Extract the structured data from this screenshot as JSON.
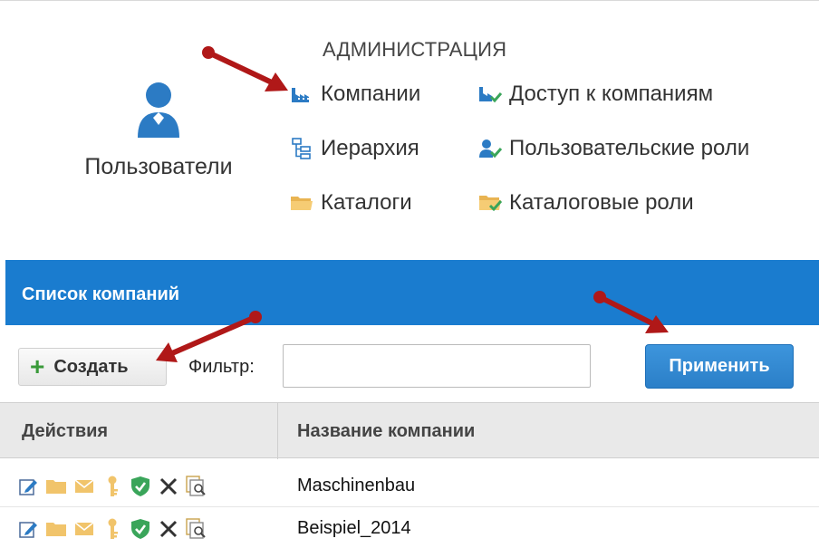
{
  "users": {
    "label": "Пользователи"
  },
  "admin": {
    "title": "АДМИНИСТРАЦИЯ",
    "items": [
      {
        "label": "Компании",
        "icon": "factory-icon"
      },
      {
        "label": "Доступ к компаниям",
        "icon": "factory-check-icon"
      },
      {
        "label": "Иерархия",
        "icon": "hierarchy-icon"
      },
      {
        "label": "Пользовательские роли",
        "icon": "user-check-icon"
      },
      {
        "label": "Каталоги",
        "icon": "folder-icon"
      },
      {
        "label": "Каталоговые роли",
        "icon": "folder-check-icon"
      }
    ]
  },
  "panel": {
    "title": "Список компаний"
  },
  "toolbar": {
    "create_label": "Создать",
    "filter_label": "Фильтр:",
    "filter_value": "",
    "apply_label": "Применить"
  },
  "table": {
    "columns": [
      "Действия",
      "Название компании"
    ],
    "rows": [
      {
        "name": "Maschinenbau"
      },
      {
        "name": "Beispiel_2014"
      }
    ]
  },
  "colors": {
    "accent": "#1a7ccf",
    "annotation_arrow": "#b01818",
    "folder": "#f1c46b",
    "shield": "#3aa55a"
  }
}
